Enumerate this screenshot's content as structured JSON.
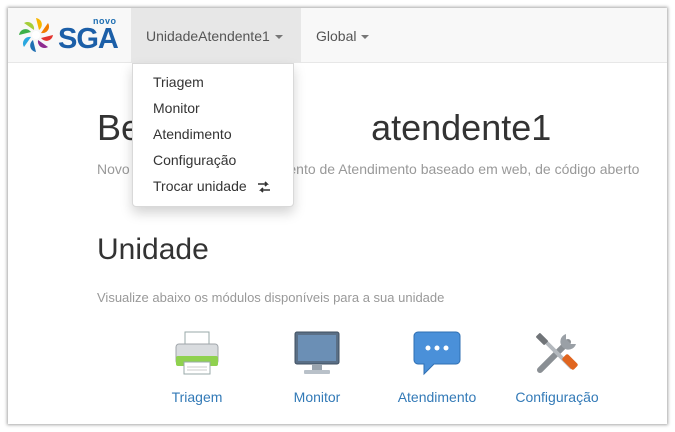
{
  "navbar": {
    "logo_small": "novo",
    "logo_main": "SGA",
    "menu_unidade": "UnidadeAtendente1",
    "menu_global": "Global"
  },
  "dropdown": {
    "items": [
      {
        "label": "Triagem"
      },
      {
        "label": "Monitor"
      },
      {
        "label": "Atendimento"
      },
      {
        "label": "Configuração"
      },
      {
        "label": "Trocar unidade",
        "icon": "swap-icon"
      }
    ]
  },
  "main": {
    "welcome_visible": "Be                       atendente1",
    "lead_visible": "Novo                                   iamento de Atendimento baseado em web, de código aberto",
    "section_title": "Unidade",
    "section_subtitle": "Visualize abaixo os módulos disponíveis para a sua unidade",
    "modules": [
      {
        "label": "Triagem",
        "icon": "printer-icon"
      },
      {
        "label": "Monitor",
        "icon": "monitor-icon"
      },
      {
        "label": "Atendimento",
        "icon": "chat-bubble-icon"
      },
      {
        "label": "Configuração",
        "icon": "tools-icon"
      }
    ]
  },
  "colors": {
    "link": "#337ab7",
    "navbar_bg": "#f8f8f8",
    "active_nav_bg": "#e7e7e7",
    "muted_text": "#999999"
  }
}
